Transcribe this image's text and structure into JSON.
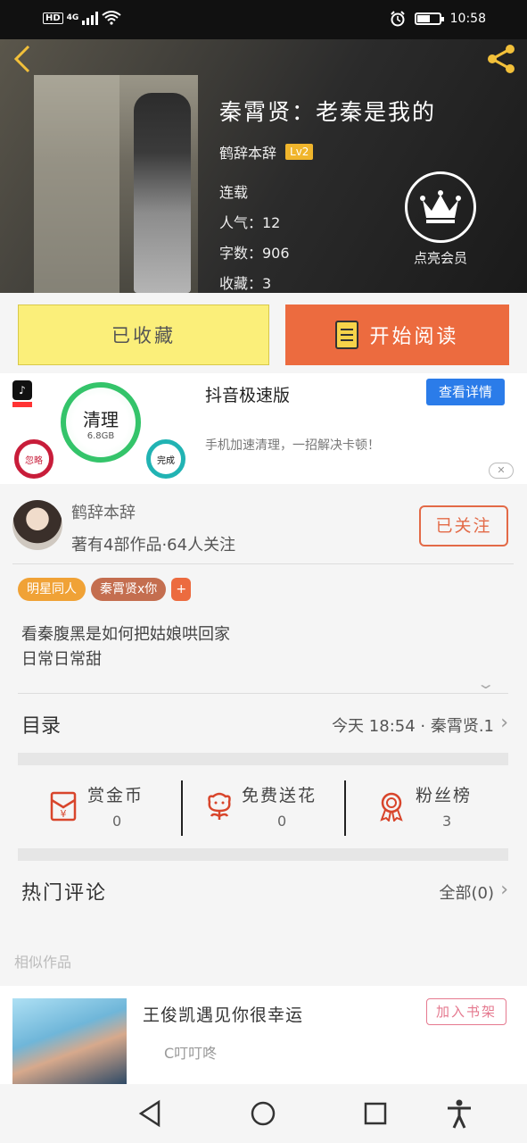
{
  "status": {
    "network": "4G",
    "hd": "HD",
    "time": "10:58"
  },
  "book": {
    "title": "秦霄贤：老秦是我的",
    "author": "鹤辞本辞",
    "level": "Lv2",
    "status": "连载",
    "popularity": "人气：12",
    "words": "字数：906",
    "favorites": "收藏：3",
    "vip_label": "点亮会员"
  },
  "actions": {
    "collected": "已收藏",
    "start_reading": "开始阅读"
  },
  "ad": {
    "title": "抖音极速版",
    "button": "查看详情",
    "desc": "手机加速清理，一招解决卡顿！",
    "clean": "清理",
    "size": "6.8GB",
    "ignore": "忽略",
    "done": "完成",
    "close": "✕"
  },
  "author": {
    "name": "鹤辞本辞",
    "stats": "著有4部作品·64人关注",
    "follow": "已关注"
  },
  "tags": [
    {
      "label": "明星同人",
      "color": "#f0a236"
    },
    {
      "label": "秦霄贤x你",
      "color": "#c46e4f"
    },
    {
      "label": "+",
      "color": "#ec6b3f"
    }
  ],
  "description": [
    "看秦腹黑是如何把姑娘哄回家",
    "日常日常甜"
  ],
  "catalog": {
    "label": "目录",
    "latest": "今天 18:54 · 秦霄贤.1"
  },
  "stats": [
    {
      "name": "赏金币",
      "value": "0",
      "icon": "red-envelope-icon"
    },
    {
      "name": "免费送花",
      "value": "0",
      "icon": "flower-icon"
    },
    {
      "name": "粉丝榜",
      "value": "3",
      "icon": "medal-icon"
    }
  ],
  "comments": {
    "label": "热门评论",
    "all": "全部(0)"
  },
  "similar": {
    "section_title": "相似作品",
    "items": [
      {
        "title": "王俊凯遇见你很幸运",
        "author": "C叮叮咚",
        "button": "加入书架"
      }
    ]
  },
  "colors": {
    "accent": "#ec6b3f",
    "gold": "#f2c03a",
    "collected": "#fbef7a",
    "ad_button": "#2b7ce9"
  }
}
